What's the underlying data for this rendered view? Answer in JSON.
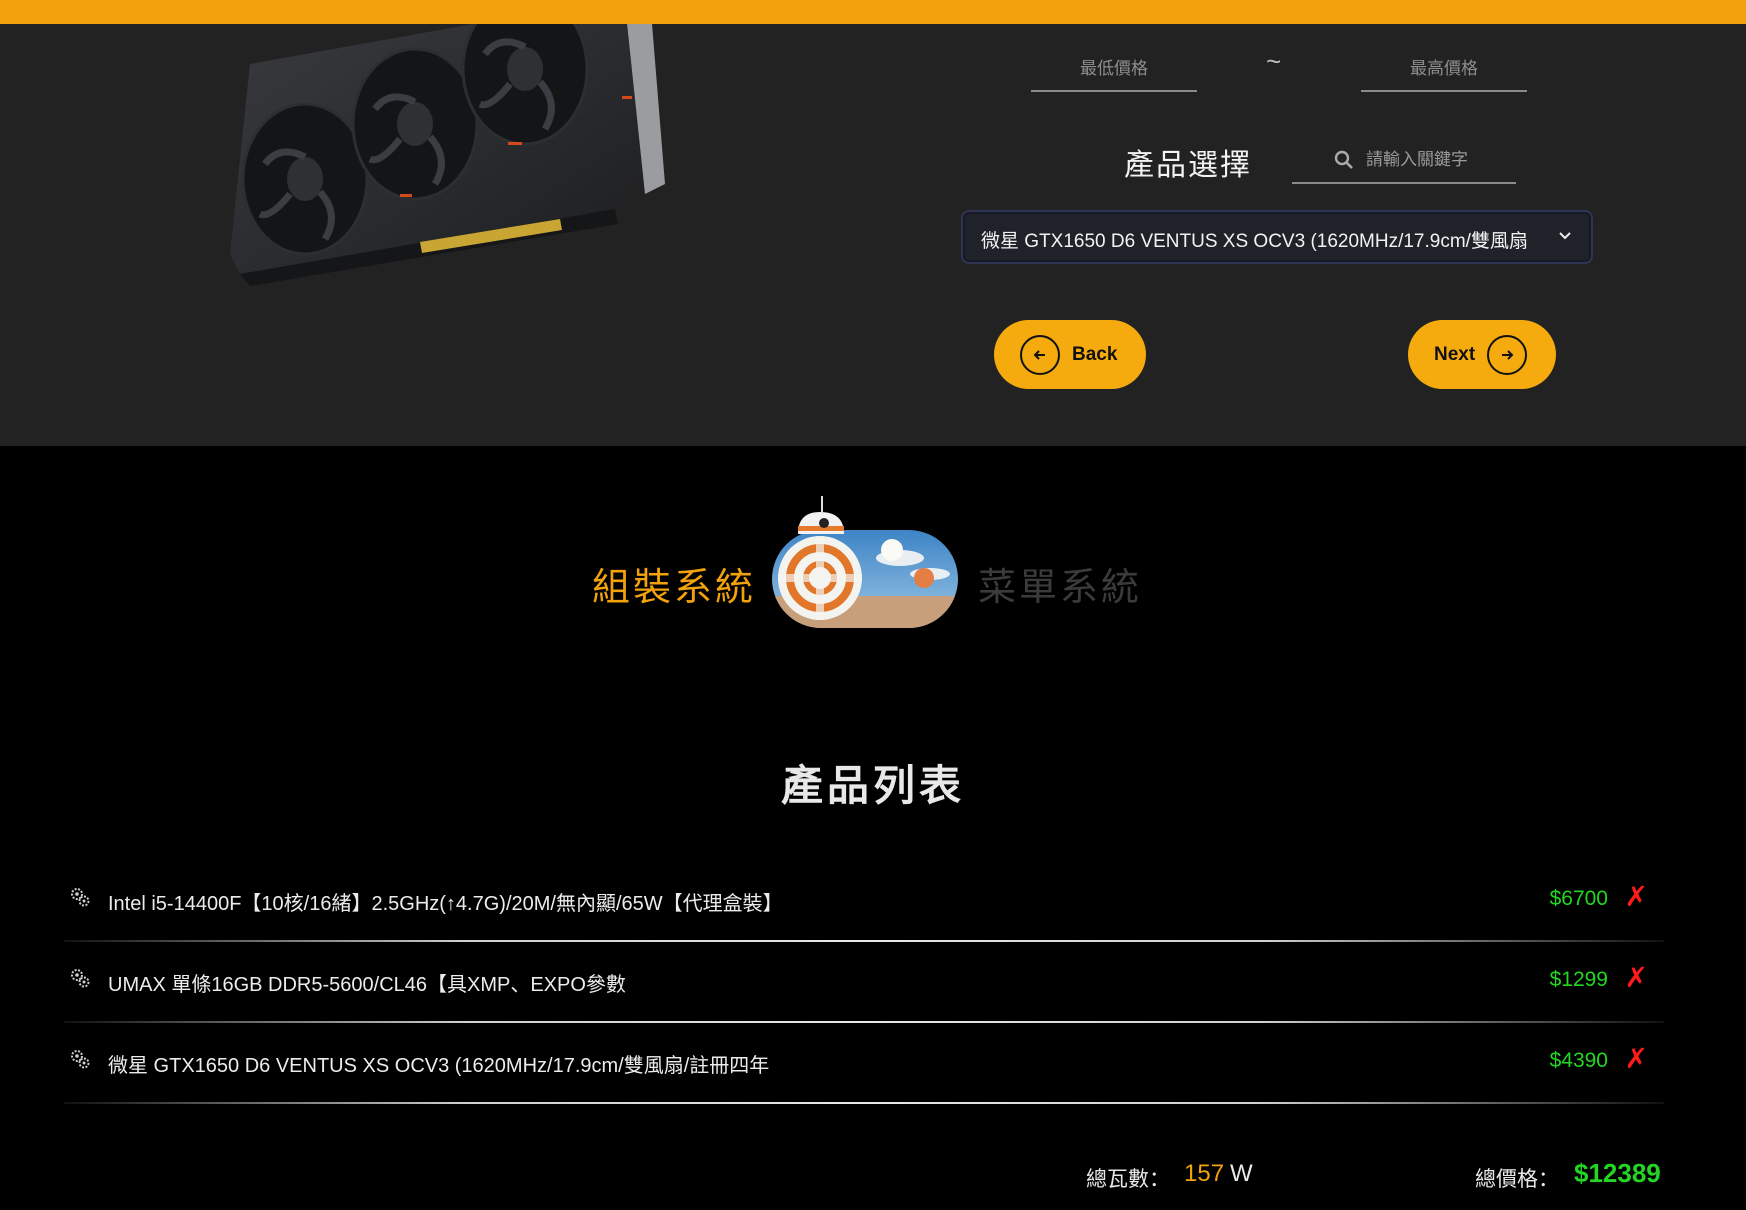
{
  "filter": {
    "min_price_placeholder": "最低價格",
    "max_price_placeholder": "最高價格",
    "range_separator": "~",
    "section_label": "產品選擇",
    "search_placeholder": "請輸入關鍵字",
    "selected_product": "微星 GTX1650 D6 VENTUS XS OCV3 (1620MHz/17.9cm/雙風扇"
  },
  "nav": {
    "back_label": "Back",
    "next_label": "Next"
  },
  "mode_toggle": {
    "left_label": "組裝系統",
    "right_label": "菜單系統",
    "active": "left"
  },
  "product_list": {
    "title": "產品列表",
    "items": [
      {
        "name": "Intel i5-14400F【10核/16緒】2.5GHz(↑4.7G)/20M/無內顯/65W【代理盒裝】",
        "price": "$6700",
        "remove": "✗"
      },
      {
        "name": "UMAX 單條16GB DDR5-5600/CL46【具XMP、EXPO參數",
        "price": "$1299",
        "remove": "✗"
      },
      {
        "name": "微星 GTX1650 D6 VENTUS XS OCV3 (1620MHz/17.9cm/雙風扇/註冊四年",
        "price": "$4390",
        "remove": "✗"
      }
    ]
  },
  "totals": {
    "watt_label": "總瓦數：",
    "watt_value": "157",
    "watt_unit": "W",
    "price_label": "總價格：",
    "price_value": "$12389"
  },
  "colors": {
    "accent": "#f2a20a",
    "price_green": "#22d622",
    "remove_red": "#ff1a1a",
    "panel_bg": "#222222"
  }
}
